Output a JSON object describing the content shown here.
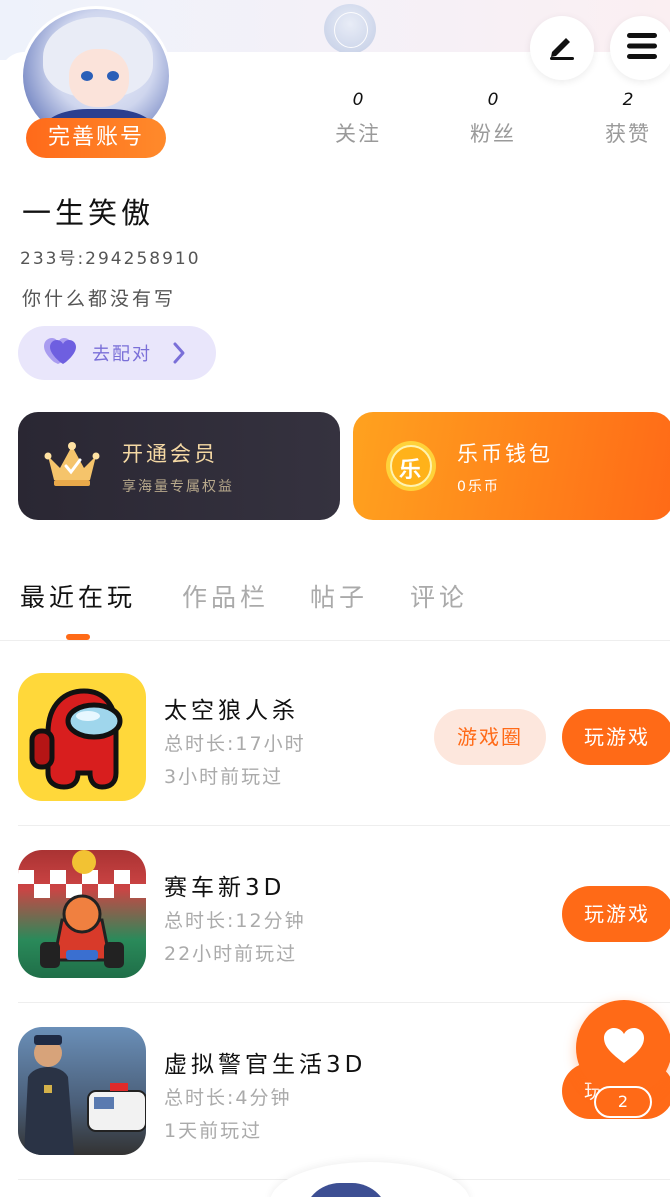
{
  "profile": {
    "complete_label": "完善账号",
    "nickname": "一生笑傲",
    "uid": "233号:294258910",
    "bio": "你什么都没有写"
  },
  "stats": [
    {
      "value": "0",
      "label": "关注"
    },
    {
      "value": "0",
      "label": "粉丝"
    },
    {
      "value": "2",
      "label": "获赞"
    }
  ],
  "match": {
    "label": "去配对"
  },
  "vip": {
    "title": "开通会员",
    "subtitle": "享海量专属权益"
  },
  "wallet": {
    "title": "乐币钱包",
    "subtitle": "0乐币",
    "coin_glyph": "乐"
  },
  "tabs": [
    {
      "label": "最近在玩",
      "active": true
    },
    {
      "label": "作品栏",
      "active": false
    },
    {
      "label": "帖子",
      "active": false
    },
    {
      "label": "评论",
      "active": false
    }
  ],
  "games": [
    {
      "name": "太空狼人杀",
      "duration": "总时长:17小时",
      "last_played": "3小时前玩过",
      "circle_label": "游戏圈",
      "play_label": "玩游戏"
    },
    {
      "name": "赛车新3D",
      "duration": "总时长:12分钟",
      "last_played": "22小时前玩过",
      "play_label": "玩游戏"
    },
    {
      "name": "虚拟警官生活3D",
      "duration": "总时长:4分钟",
      "last_played": "1天前玩过",
      "play_label": "玩"
    }
  ],
  "fab": {
    "badge": "2",
    "icon": "heart-icon"
  },
  "colors": {
    "accent": "#ff6a17",
    "vip_bg": "#2a2733",
    "match_bg": "#e9e6fb",
    "match_text": "#7a6fd8"
  }
}
